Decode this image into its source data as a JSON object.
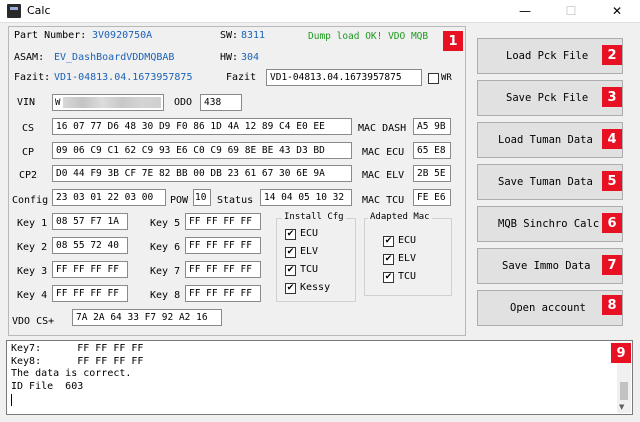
{
  "window": {
    "title": "Calc",
    "minimize": "—",
    "maximize": "☐",
    "close": "✕"
  },
  "info": {
    "part_number_label": "Part Number:",
    "part_number": "3V0920750A",
    "sw_label": "SW:",
    "sw": "8311",
    "status_msg": "Dump load OK! VDO MQB",
    "asam_label": "ASAM:",
    "asam": "EV_DashBoardVDDMQBAB",
    "hw_label": "HW:",
    "hw": "304",
    "fazit_label": "Fazit:",
    "fazit": "VD1-04813.04.1673957875",
    "fazit_field_label": "Fazit",
    "fazit_field": "VD1-04813.04.1673957875",
    "wr_label": "WR",
    "vin_label": "VIN",
    "vin_prefix": "W",
    "odo_label": "ODO",
    "odo": "438"
  },
  "rows": {
    "cs_label": "CS",
    "cs": "16 07 77 D6 48 30 D9 F0 86 1D 4A 12 89 C4 E0 EE",
    "mac_dash_label": "MAC DASH",
    "mac_dash": "A5 9B",
    "cp_label": "CP",
    "cp": "09 06 C9 C1 62 C9 93 E6 C0 C9 69 8E BE 43 D3 BD",
    "mac_ecu_label": "MAC ECU",
    "mac_ecu": "65 E8",
    "cp2_label": "CP2",
    "cp2": "D0 44 F9 3B CF 7E 82 BB 00 DB 23 61 67 30 6E 9A",
    "mac_elv_label": "MAC ELV",
    "mac_elv": "2B 5E",
    "config_label": "Config",
    "config": "23 03 01 22 03 00",
    "pow_label": "POW",
    "pow": "10",
    "status_label": "Status",
    "status": "14 04 05 10 32",
    "mac_tcu_label": "MAC TCU",
    "mac_tcu": "FE E6"
  },
  "keys": [
    {
      "label": "Key 1",
      "value": "08 57 F7 1A"
    },
    {
      "label": "Key 2",
      "value": "08 55 72 40"
    },
    {
      "label": "Key 3",
      "value": "FF FF FF FF"
    },
    {
      "label": "Key 4",
      "value": "FF FF FF FF"
    },
    {
      "label": "Key 5",
      "value": "FF FF FF FF"
    },
    {
      "label": "Key 6",
      "value": "FF FF FF FF"
    },
    {
      "label": "Key 7",
      "value": "FF FF FF FF"
    },
    {
      "label": "Key 8",
      "value": "FF FF FF FF"
    }
  ],
  "install_cfg": {
    "title": "Install Cfg",
    "items": [
      "ECU",
      "ELV",
      "TCU",
      "Kessy"
    ]
  },
  "adapted_mac": {
    "title": "Adapted Mac",
    "items": [
      "ECU",
      "ELV",
      "TCU"
    ]
  },
  "vdo_cs_label": "VDO CS+",
  "vdo_cs": "7A 2A 64 33 F7 92 A2 16",
  "buttons": [
    {
      "label": "Load Pck File",
      "badge": "2"
    },
    {
      "label": "Save Pck File",
      "badge": "3"
    },
    {
      "label": "Load Tuman Data",
      "badge": "4"
    },
    {
      "label": "Save Tuman Data",
      "badge": "5"
    },
    {
      "label": "MQB Sinchro Calc",
      "badge": "6"
    },
    {
      "label": "Save Immo Data",
      "badge": "7"
    },
    {
      "label": "Open account",
      "badge": "8"
    }
  ],
  "badges": {
    "panel": "1",
    "log": "9"
  },
  "log": [
    "Key7:      FF FF FF FF",
    "Key8:      FF FF FF FF",
    "The data is correct.",
    "ID File  603"
  ]
}
